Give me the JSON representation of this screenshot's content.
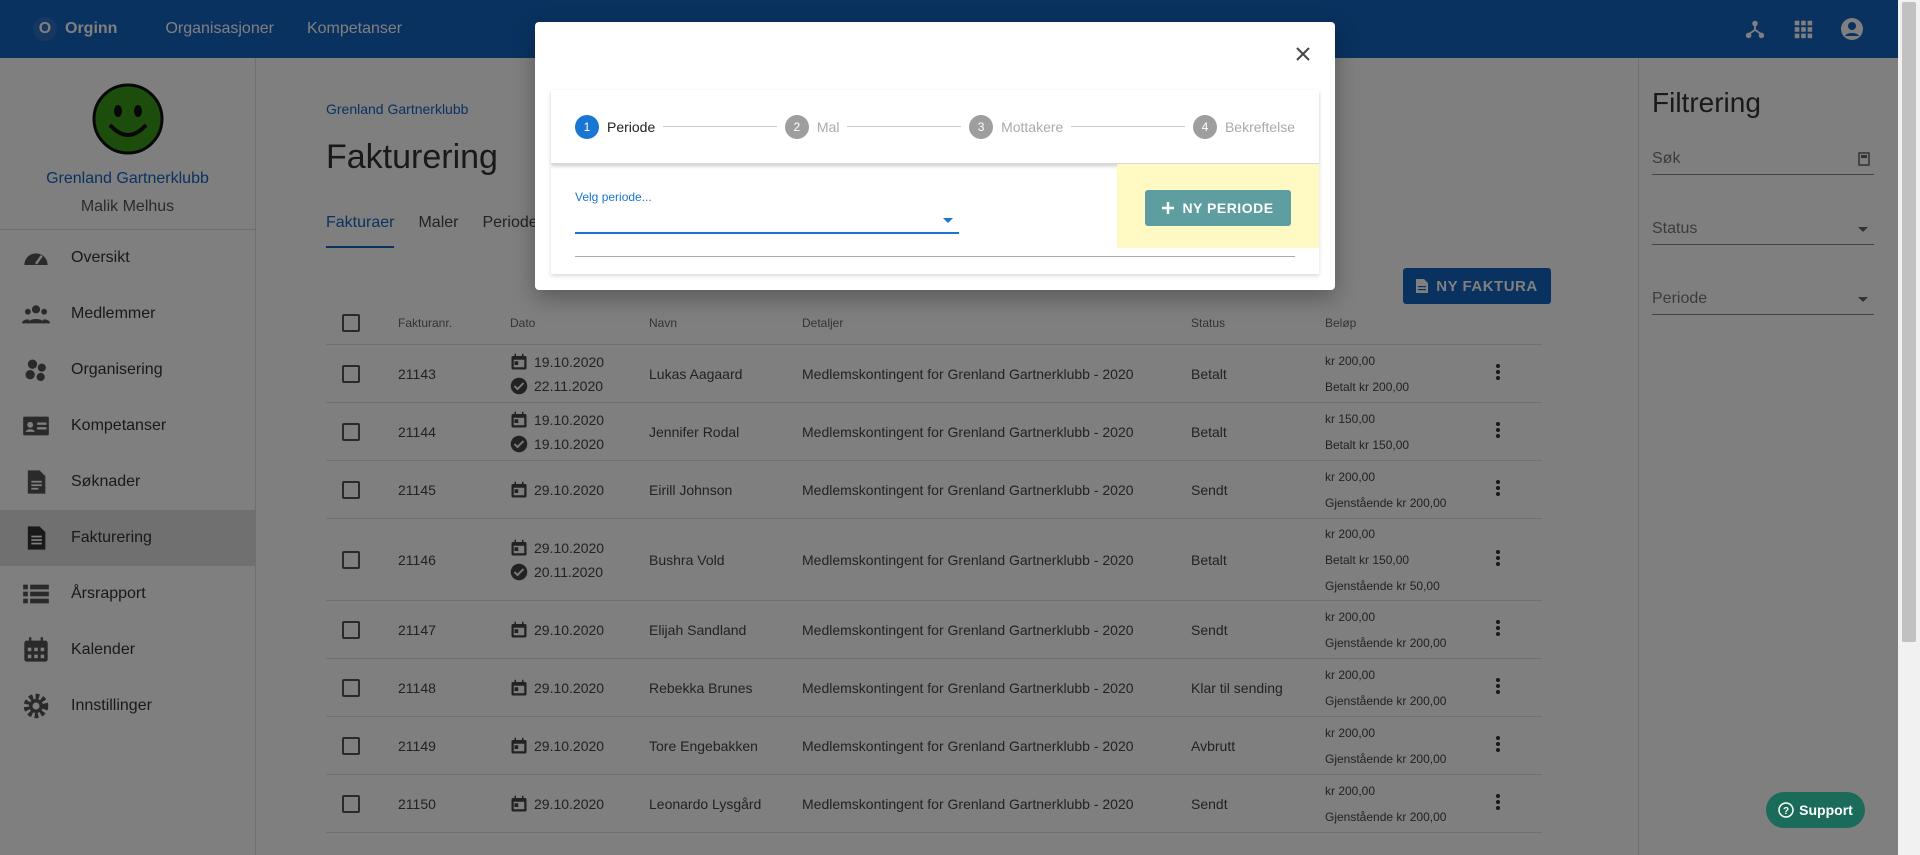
{
  "topbar": {
    "brand_initial": "O",
    "brand_name": "Orginn",
    "nav": [
      "Organisasjoner",
      "Kompetanser"
    ]
  },
  "sidebar": {
    "org_name": "Grenland Gartnerklubb",
    "user_name": "Malik Melhus",
    "items": [
      {
        "label": "Oversikt",
        "icon": "dashboard-icon"
      },
      {
        "label": "Medlemmer",
        "icon": "people-icon"
      },
      {
        "label": "Organisering",
        "icon": "organization-icon"
      },
      {
        "label": "Kompetanser",
        "icon": "id-card-icon"
      },
      {
        "label": "Søknader",
        "icon": "document-icon"
      },
      {
        "label": "Fakturering",
        "icon": "invoice-icon",
        "active": true
      },
      {
        "label": "Årsrapport",
        "icon": "list-icon"
      },
      {
        "label": "Kalender",
        "icon": "calendar-icon"
      },
      {
        "label": "Innstillinger",
        "icon": "gear-icon"
      }
    ]
  },
  "main": {
    "breadcrumb": "Grenland Gartnerklubb",
    "title": "Fakturering",
    "tabs": [
      "Fakturaer",
      "Maler",
      "Periode"
    ],
    "new_invoice_label": "NY FAKTURA",
    "table": {
      "headers": [
        "Fakturanr.",
        "Dato",
        "Navn",
        "Detaljer",
        "Status",
        "Beløp"
      ],
      "rows": [
        {
          "nr": "21143",
          "dates": [
            "19.10.2020",
            "22.11.2020"
          ],
          "name": "Lukas Aagaard",
          "details": "Medlemskontingent for Grenland Gartnerklubb - 2020",
          "status": "Betalt",
          "amounts": [
            "kr 200,00",
            "Betalt kr 200,00"
          ]
        },
        {
          "nr": "21144",
          "dates": [
            "19.10.2020",
            "19.10.2020"
          ],
          "name": "Jennifer Rodal",
          "details": "Medlemskontingent for Grenland Gartnerklubb - 2020",
          "status": "Betalt",
          "amounts": [
            "kr 150,00",
            "Betalt kr 150,00"
          ]
        },
        {
          "nr": "21145",
          "dates": [
            "29.10.2020"
          ],
          "name": "Eirill Johnson",
          "details": "Medlemskontingent for Grenland Gartnerklubb - 2020",
          "status": "Sendt",
          "amounts": [
            "kr 200,00",
            "Gjenstående kr 200,00"
          ]
        },
        {
          "nr": "21146",
          "dates": [
            "29.10.2020",
            "20.11.2020"
          ],
          "name": "Bushra Vold",
          "details": "Medlemskontingent for Grenland Gartnerklubb - 2020",
          "status": "Betalt",
          "amounts": [
            "kr 200,00",
            "Betalt kr 150,00",
            "Gjenstående kr 50,00"
          ]
        },
        {
          "nr": "21147",
          "dates": [
            "29.10.2020"
          ],
          "name": "Elijah Sandland",
          "details": "Medlemskontingent for Grenland Gartnerklubb - 2020",
          "status": "Sendt",
          "amounts": [
            "kr 200,00",
            "Gjenstående kr 200,00"
          ]
        },
        {
          "nr": "21148",
          "dates": [
            "29.10.2020"
          ],
          "name": "Rebekka Brunes",
          "details": "Medlemskontingent for Grenland Gartnerklubb - 2020",
          "status": "Klar til sending",
          "amounts": [
            "kr 200,00",
            "Gjenstående kr 200,00"
          ]
        },
        {
          "nr": "21149",
          "dates": [
            "29.10.2020"
          ],
          "name": "Tore Engebakken",
          "details": "Medlemskontingent for Grenland Gartnerklubb - 2020",
          "status": "Avbrutt",
          "amounts": [
            "kr 200,00",
            "Gjenstående kr 200,00"
          ]
        },
        {
          "nr": "21150",
          "dates": [
            "29.10.2020"
          ],
          "name": "Leonardo Lysgård",
          "details": "Medlemskontingent for Grenland Gartnerklubb - 2020",
          "status": "Sendt",
          "amounts": [
            "kr 200,00",
            "Gjenstående kr 200,00"
          ]
        }
      ]
    }
  },
  "filter": {
    "title": "Filtrering",
    "search_placeholder": "Søk",
    "status_label": "Status",
    "period_label": "Periode"
  },
  "modal": {
    "steps": [
      {
        "num": "1",
        "label": "Periode",
        "active": true
      },
      {
        "num": "2",
        "label": "Mal"
      },
      {
        "num": "3",
        "label": "Mottakere"
      },
      {
        "num": "4",
        "label": "Bekreftelse"
      }
    ],
    "period_select_label": "Velg periode...",
    "new_period_label": "NY PERIODE"
  },
  "support_label": "Support",
  "colors": {
    "primary": "#1565c0",
    "step_active": "#1976d2",
    "teal_button": "#5f9ea0",
    "highlight": "#fff9c4",
    "support": "#1b6b5a"
  }
}
